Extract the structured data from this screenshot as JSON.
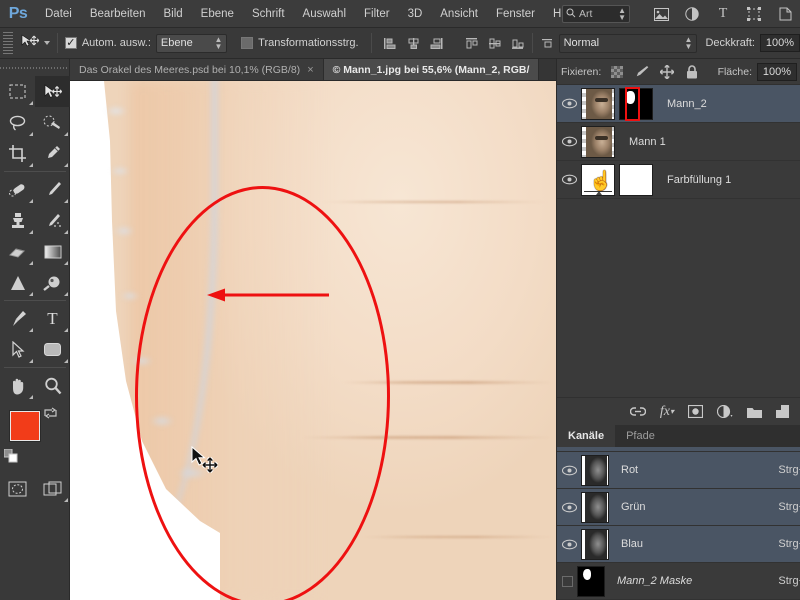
{
  "app": {
    "logo": "Ps"
  },
  "menubar": {
    "items": [
      {
        "label": "Datei"
      },
      {
        "label": "Bearbeiten"
      },
      {
        "label": "Bild"
      },
      {
        "label": "Ebene"
      },
      {
        "label": "Schrift"
      },
      {
        "label": "Auswahl"
      },
      {
        "label": "Filter"
      },
      {
        "label": "3D"
      },
      {
        "label": "Ansicht"
      },
      {
        "label": "Fenster"
      },
      {
        "label": "H"
      }
    ],
    "search": {
      "value": "Art",
      "icon": "search-icon"
    },
    "workspace_icons": [
      "image-icon",
      "adjustment-icon",
      "type-icon",
      "transform-icon",
      "arrange-icon"
    ]
  },
  "optionsbar": {
    "auto_select_label": "Autom. ausw.:",
    "auto_select_checked": true,
    "layer_dropdown_value": "Ebene",
    "transform_controls_label": "Transformationsstrg.",
    "transform_controls_checked": false,
    "blend_mode_value": "Normal",
    "opacity_label": "Deckkraft:",
    "opacity_value": "100%"
  },
  "tabs": [
    {
      "label": "Das Orakel des Meeres.psd bei 10,1% (RGB/8)",
      "active": false,
      "closable": true
    },
    {
      "label": "© Mann_1.jpg bei 55,6% (Mann_2, RGB/",
      "active": true,
      "closable": false
    }
  ],
  "toolbar": {
    "tools": [
      {
        "name": "marquee-tool",
        "glyph": "▭",
        "active": false
      },
      {
        "name": "move-tool",
        "glyph": "✥",
        "active": true
      },
      {
        "name": "lasso-tool",
        "glyph": "◯",
        "active": false
      },
      {
        "name": "quick-selection-tool",
        "glyph": "✧",
        "active": false
      },
      {
        "name": "crop-tool",
        "glyph": "⌗",
        "active": false
      },
      {
        "name": "eyedropper-tool",
        "glyph": "⟋",
        "active": false
      },
      {
        "name": "healing-brush-tool",
        "glyph": "✒",
        "active": false
      },
      {
        "name": "brush-tool",
        "glyph": "✎",
        "active": false
      },
      {
        "name": "clone-stamp-tool",
        "glyph": "⌷",
        "active": false
      },
      {
        "name": "history-brush-tool",
        "glyph": "✏",
        "active": false
      },
      {
        "name": "eraser-tool",
        "glyph": "▰",
        "active": false
      },
      {
        "name": "gradient-tool",
        "glyph": "▮",
        "active": false
      },
      {
        "name": "blur-tool",
        "glyph": "▲",
        "active": false
      },
      {
        "name": "dodge-tool",
        "glyph": "◕",
        "active": false
      },
      {
        "name": "pen-tool",
        "glyph": "✑",
        "active": false
      },
      {
        "name": "type-tool",
        "glyph": "T",
        "active": false
      },
      {
        "name": "path-selection-tool",
        "glyph": "➤",
        "active": false
      },
      {
        "name": "rectangle-tool",
        "glyph": "▢",
        "active": false
      },
      {
        "name": "hand-tool",
        "glyph": "✋",
        "active": false
      },
      {
        "name": "zoom-tool",
        "glyph": "⚲",
        "active": false
      }
    ],
    "foreground_color": "#f23c19",
    "background_color": "#ffffff",
    "quickmask_icon": "quick-mask-icon",
    "screenmode_icon": "screen-mode-icon"
  },
  "canvas": {
    "annotation_color": "#ee1111",
    "annotation_shapes": [
      "ellipse-annotation",
      "arrow-annotation"
    ],
    "cursor": "move-tool-cursor"
  },
  "layers_panel": {
    "lock_label": "Fixieren:",
    "lock_icons": [
      "lock-transparent-pixels-icon",
      "lock-image-pixels-icon",
      "lock-position-icon",
      "lock-all-icon"
    ],
    "fill_label": "Fläche:",
    "fill_value": "100%",
    "layers": [
      {
        "name": "Mann_2",
        "visible": true,
        "selected": true,
        "has_mask": true
      },
      {
        "name": "Mann 1",
        "visible": true,
        "selected": false,
        "has_mask": false
      },
      {
        "name": "Farbfüllung 1",
        "visible": true,
        "selected": false,
        "has_mask": true
      }
    ],
    "bottom_icons": [
      "link-layers-icon",
      "layer-style-fx-icon",
      "add-mask-icon",
      "adjustment-layer-icon",
      "new-group-folder-icon",
      "new-layer-icon"
    ]
  },
  "channels_panel": {
    "tabs": [
      {
        "label": "Kanäle",
        "active": true
      },
      {
        "label": "Pfade",
        "active": false
      }
    ],
    "channels": [
      {
        "name": "Rot",
        "shortcut": "Strg+",
        "visible": true,
        "selected": true,
        "italic": false
      },
      {
        "name": "Grün",
        "shortcut": "Strg+",
        "visible": true,
        "selected": true,
        "italic": false
      },
      {
        "name": "Blau",
        "shortcut": "Strg+",
        "visible": true,
        "selected": true,
        "italic": false
      },
      {
        "name": "Mann_2 Maske",
        "shortcut": "Strg+",
        "visible": false,
        "selected": false,
        "italic": true
      }
    ]
  }
}
